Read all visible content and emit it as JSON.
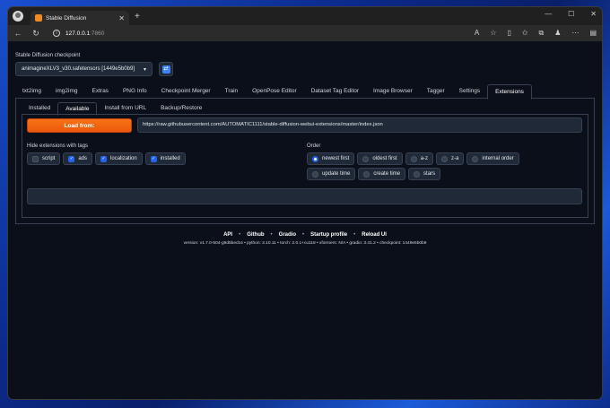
{
  "browser": {
    "tab_title": "Stable Diffusion",
    "new_tab_icon": "plus-icon",
    "url_host": "127.0.0.1",
    "url_port": ":7860"
  },
  "app": {
    "checkpoint_label": "Stable Diffusion checkpoint",
    "checkpoint_value": "animagineXLV3_v30.safetensors [1449e5b0b9]",
    "main_tabs": [
      "txt2img",
      "img2img",
      "Extras",
      "PNG Info",
      "Checkpoint Merger",
      "Train",
      "OpenPose Editor",
      "Dataset Tag Editor",
      "Image Browser",
      "Tagger",
      "Settings",
      "Extensions"
    ],
    "active_main_tab": "Extensions",
    "sub_tabs": [
      "Installed",
      "Available",
      "Install from URL",
      "Backup/Restore"
    ],
    "active_sub_tab": "Available",
    "load_button": "Load from:",
    "index_url": "https://raw.githubusercontent.com/AUTOMATIC1111/stable-diffusion-webui-extensions/master/index.json",
    "hide_label": "Hide extensions with tags",
    "tags": [
      {
        "label": "script",
        "checked": false
      },
      {
        "label": "ads",
        "checked": true
      },
      {
        "label": "localization",
        "checked": true
      },
      {
        "label": "installed",
        "checked": true
      }
    ],
    "order_label": "Order",
    "order_options": [
      {
        "label": "newest first",
        "selected": true
      },
      {
        "label": "oldest first",
        "selected": false
      },
      {
        "label": "a-z",
        "selected": false
      },
      {
        "label": "z-a",
        "selected": false
      },
      {
        "label": "internal order",
        "selected": false
      },
      {
        "label": "update time",
        "selected": false
      },
      {
        "label": "create time",
        "selected": false
      },
      {
        "label": "stars",
        "selected": false
      }
    ]
  },
  "footer": {
    "links": [
      "API",
      "Github",
      "Gradio",
      "Startup profile",
      "Reload UI"
    ],
    "versions": "version: v1.7.0-504-g9d5becb4  •  python: 3.10.11  •  torch: 2.0.1+cu118  •  xformers: N/A  •  gradio: 3.41.2  •  checkpoint: 1449e5b0b9"
  },
  "colors": {
    "accent_orange": "#f97316",
    "checkbox_blue": "#2563eb",
    "page_bg": "#0b0f19"
  }
}
